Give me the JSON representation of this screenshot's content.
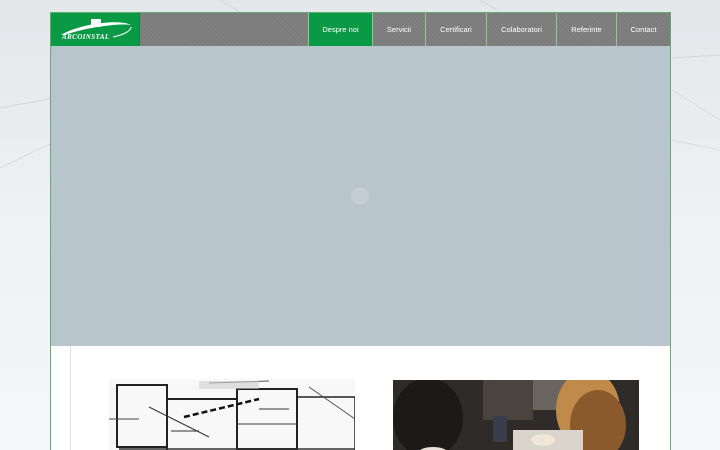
{
  "brand": {
    "name": "ARCOINSTAL",
    "color": "#0a9a46"
  },
  "nav": {
    "items": [
      {
        "label": "Despre noi",
        "active": true
      },
      {
        "label": "Servicii",
        "active": false
      },
      {
        "label": "Certificari",
        "active": false
      },
      {
        "label": "Colaboratori",
        "active": false
      },
      {
        "label": "Referinte",
        "active": false
      },
      {
        "label": "Contact",
        "active": false
      }
    ]
  },
  "hero": {
    "state": "loading",
    "icon": "loader-icon"
  },
  "thumbnails": [
    {
      "name": "architectural-plan-image"
    },
    {
      "name": "meeting-photo-image"
    }
  ]
}
